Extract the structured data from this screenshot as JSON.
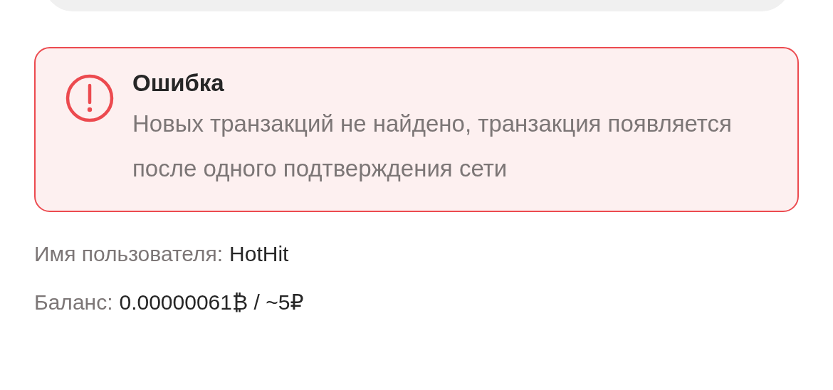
{
  "alert": {
    "kind": "error",
    "title": "Ошибка",
    "message": "Новых транзакций не найдено, транзакция появляется после одного подтверждения сети"
  },
  "info": [
    {
      "label": "Имя пользователя:",
      "value": "HotHit"
    },
    {
      "label": "Баланс:",
      "value": "0.00000061₿ / ~5₽"
    }
  ]
}
